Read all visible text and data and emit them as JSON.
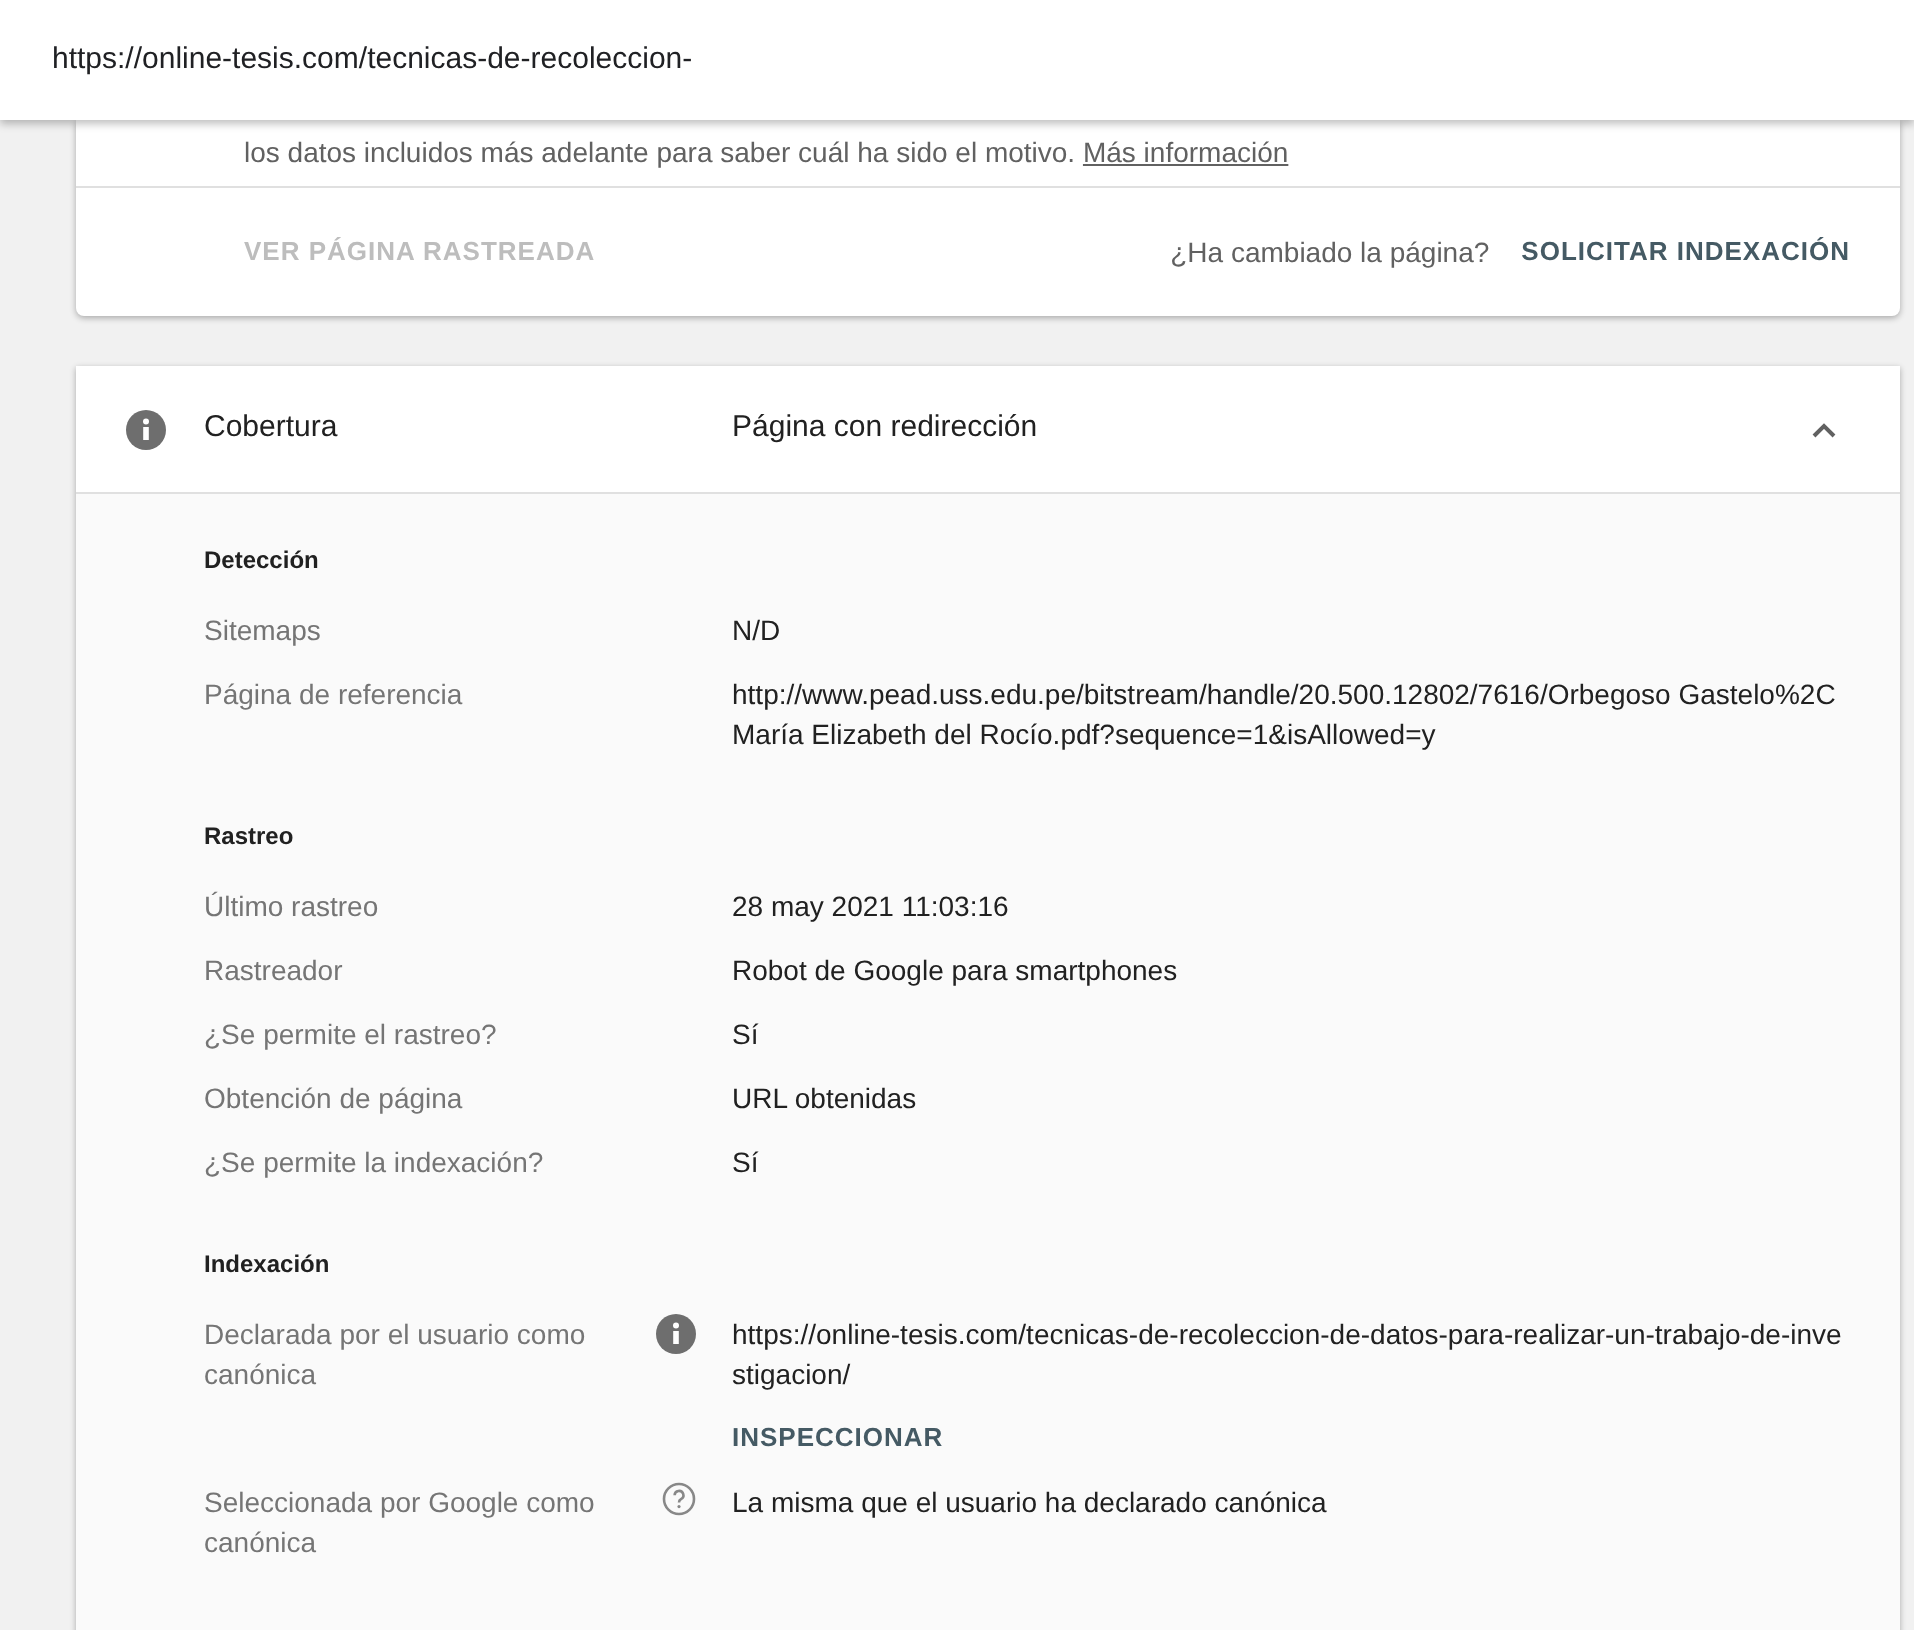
{
  "address_bar": {
    "url": "https://online-tesis.com/tecnicas-de-recoleccion-"
  },
  "top_card": {
    "note": "los datos incluidos más adelante para saber cuál ha sido el motivo.",
    "note_link": "Más información",
    "view_button": {
      "label": "VER PÁGINA RASTREADA",
      "disabled": true
    },
    "question": "¿Ha cambiado la página?",
    "request_button": {
      "label": "SOLICITAR INDEXACIÓN",
      "disabled": false
    }
  },
  "coverage": {
    "title": "Cobertura",
    "status": "Página con redirección",
    "expanded": true,
    "sections": [
      {
        "heading": "Detección",
        "rows": [
          {
            "label": "Sitemaps",
            "value": "N/D"
          },
          {
            "label": "Página de referencia",
            "value": "http://www.pead.uss.edu.pe/bitstream/handle/20.500.12802/7616/Orbegoso Gastelo%2C María Elizabeth del Rocío.pdf?sequence=1&isAllowed=y"
          }
        ]
      },
      {
        "heading": "Rastreo",
        "rows": [
          {
            "label": "Último rastreo",
            "value": "28 may 2021 11:03:16"
          },
          {
            "label": "Rastreador",
            "value": "Robot de Google para smartphones"
          },
          {
            "label": "¿Se permite el rastreo?",
            "value": "Sí"
          },
          {
            "label": "Obtención de página",
            "value": "URL obtenidas"
          },
          {
            "label": "¿Se permite la indexación?",
            "value": "Sí"
          }
        ]
      },
      {
        "heading": "Indexación",
        "rows": [
          {
            "label": "Declarada por el usuario como canónica",
            "value": "https://online-tesis.com/tecnicas-de-recoleccion-de-datos-para-realizar-un-trabajo-de-investigacion/",
            "kind": "info",
            "action": "INSPECCIONAR"
          },
          {
            "label": "Seleccionada por Google como canónica",
            "value": "La misma que el usuario ha declarado canónica",
            "kind": "help"
          }
        ]
      }
    ]
  }
}
